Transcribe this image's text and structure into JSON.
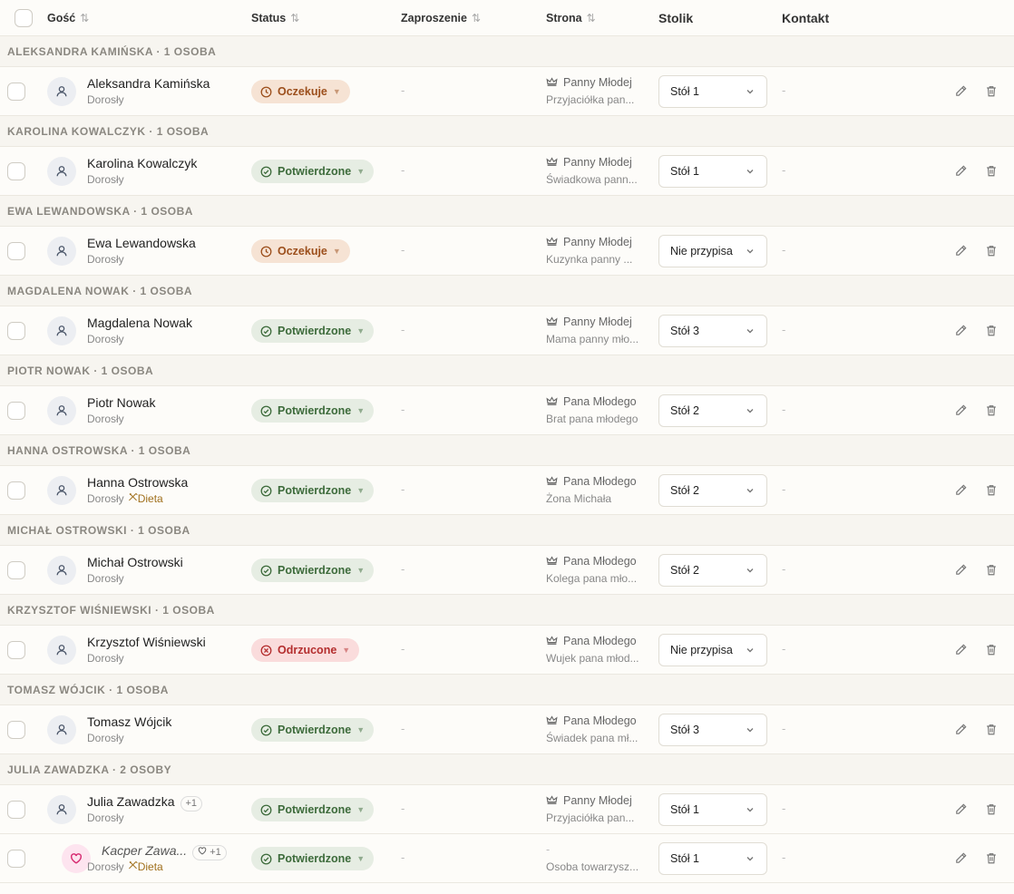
{
  "columns": {
    "guest": "Gość",
    "status": "Status",
    "invitation": "Zaproszenie",
    "side": "Strona",
    "table": "Stolik",
    "contact": "Kontakt"
  },
  "groups": [
    {
      "title": "ALEKSANDRA KAMIŃSKA · 1 OSOBA",
      "rows": [
        {
          "name": "Aleksandra Kamińska",
          "type": "Dorosły",
          "diet": "",
          "plus": "",
          "status": "Oczekuje",
          "state": "wait",
          "invitation": "-",
          "side": "Panny Młodej",
          "relation": "Przyjaciółka pan...",
          "table": "Stół 1",
          "contact": "-"
        }
      ]
    },
    {
      "title": "KAROLINA KOWALCZYK · 1 OSOBA",
      "rows": [
        {
          "name": "Karolina Kowalczyk",
          "type": "Dorosły",
          "diet": "",
          "plus": "",
          "status": "Potwierdzone",
          "state": "ok",
          "invitation": "-",
          "side": "Panny Młodej",
          "relation": "Świadkowa pann...",
          "table": "Stół 1",
          "contact": "-"
        }
      ]
    },
    {
      "title": "EWA LEWANDOWSKA · 1 OSOBA",
      "rows": [
        {
          "name": "Ewa Lewandowska",
          "type": "Dorosły",
          "diet": "",
          "plus": "",
          "status": "Oczekuje",
          "state": "wait",
          "invitation": "-",
          "side": "Panny Młodej",
          "relation": "Kuzynka panny ...",
          "table": "Nie przypisa",
          "contact": "-"
        }
      ]
    },
    {
      "title": "MAGDALENA NOWAK · 1 OSOBA",
      "rows": [
        {
          "name": "Magdalena Nowak",
          "type": "Dorosły",
          "diet": "",
          "plus": "",
          "status": "Potwierdzone",
          "state": "ok",
          "invitation": "-",
          "side": "Panny Młodej",
          "relation": "Mama panny mło...",
          "table": "Stół 3",
          "contact": "-"
        }
      ]
    },
    {
      "title": "PIOTR NOWAK · 1 OSOBA",
      "rows": [
        {
          "name": "Piotr Nowak",
          "type": "Dorosły",
          "diet": "",
          "plus": "",
          "status": "Potwierdzone",
          "state": "ok",
          "invitation": "-",
          "side": "Pana Młodego",
          "relation": "Brat pana młodego",
          "table": "Stół 2",
          "contact": "-"
        }
      ]
    },
    {
      "title": "HANNA OSTROWSKA · 1 OSOBA",
      "rows": [
        {
          "name": "Hanna Ostrowska",
          "type": "Dorosły",
          "diet": "Dieta",
          "plus": "",
          "status": "Potwierdzone",
          "state": "ok",
          "invitation": "-",
          "side": "Pana Młodego",
          "relation": "Żona Michała",
          "table": "Stół 2",
          "contact": "-"
        }
      ]
    },
    {
      "title": "MICHAŁ OSTROWSKI · 1 OSOBA",
      "rows": [
        {
          "name": "Michał Ostrowski",
          "type": "Dorosły",
          "diet": "",
          "plus": "",
          "status": "Potwierdzone",
          "state": "ok",
          "invitation": "-",
          "side": "Pana Młodego",
          "relation": "Kolega pana mło...",
          "table": "Stół 2",
          "contact": "-"
        }
      ]
    },
    {
      "title": "KRZYSZTOF WIŚNIEWSKI · 1 OSOBA",
      "rows": [
        {
          "name": "Krzysztof Wiśniewski",
          "type": "Dorosły",
          "diet": "",
          "plus": "",
          "status": "Odrzucone",
          "state": "no",
          "invitation": "-",
          "side": "Pana Młodego",
          "relation": "Wujek pana młod...",
          "table": "Nie przypisa",
          "contact": "-"
        }
      ]
    },
    {
      "title": "TOMASZ WÓJCIK · 1 OSOBA",
      "rows": [
        {
          "name": "Tomasz Wójcik",
          "type": "Dorosły",
          "diet": "",
          "plus": "",
          "status": "Potwierdzone",
          "state": "ok",
          "invitation": "-",
          "side": "Pana Młodego",
          "relation": "Świadek pana mł...",
          "table": "Stół 3",
          "contact": "-"
        }
      ]
    },
    {
      "title": "JULIA ZAWADZKA · 2 OSOBY",
      "rows": [
        {
          "name": "Julia Zawadzka",
          "type": "Dorosły",
          "diet": "",
          "plus": "+1",
          "status": "Potwierdzone",
          "state": "ok",
          "invitation": "-",
          "side": "Panny Młodej",
          "relation": "Przyjaciółka pan...",
          "table": "Stół 1",
          "contact": "-"
        },
        {
          "name": "Kacper Zawa...",
          "type": "Dorosły",
          "diet": "Dieta",
          "plus": "+1",
          "companion": true,
          "status": "Potwierdzone",
          "state": "ok",
          "invitation": "-",
          "side": "-",
          "relation": "Osoba towarzysz...",
          "table": "Stół 1",
          "contact": "-"
        }
      ]
    }
  ]
}
